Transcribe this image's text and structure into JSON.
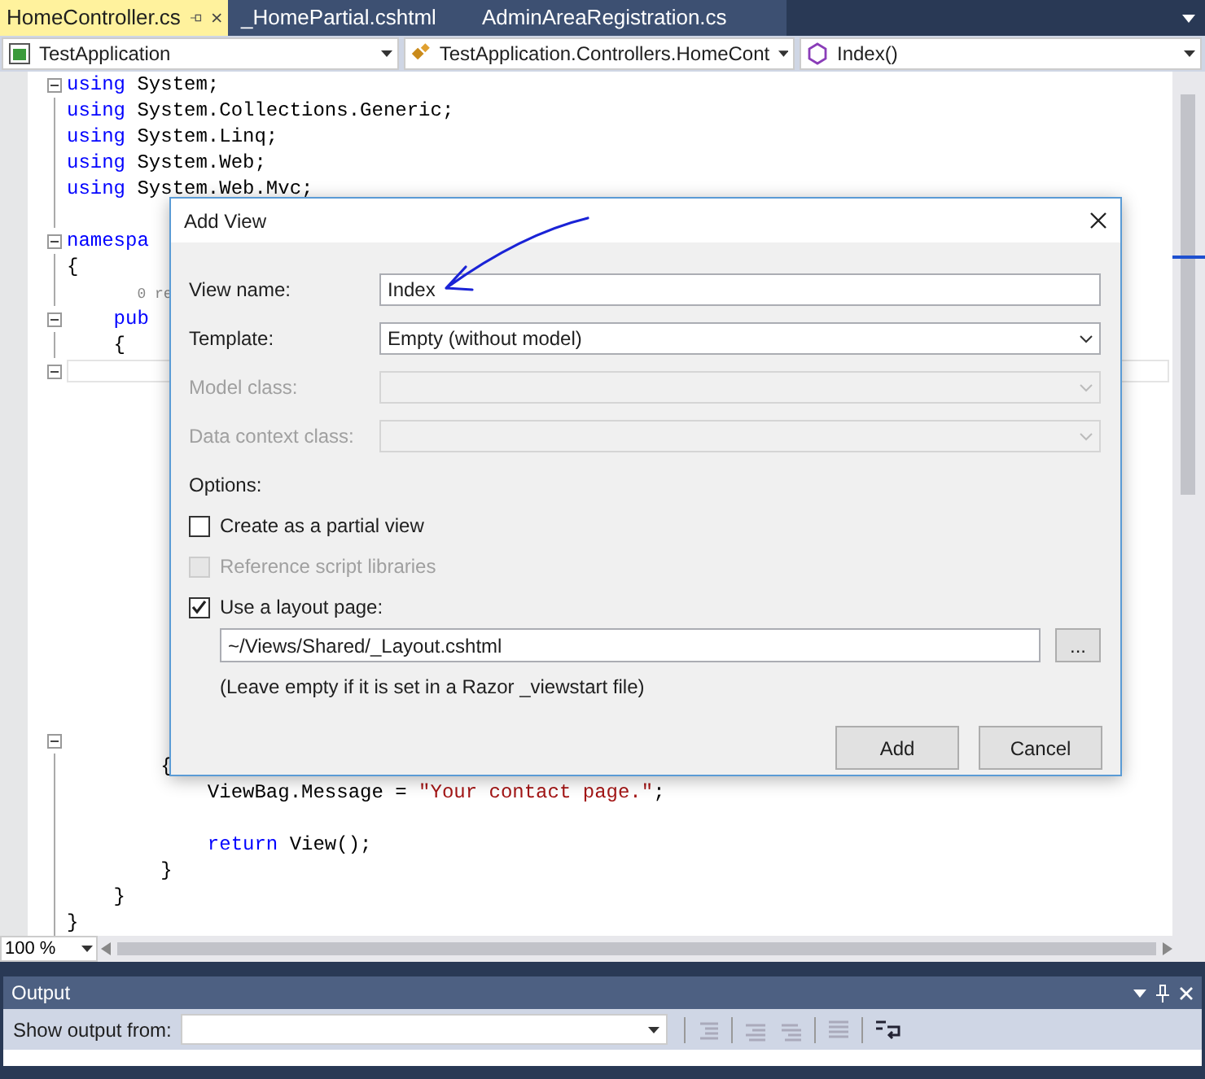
{
  "tabs": [
    {
      "label": "HomeController.cs",
      "selected": true
    },
    {
      "label": "_HomePartial.cshtml",
      "selected": false
    },
    {
      "label": "AdminAreaRegistration.cs",
      "selected": false
    }
  ],
  "nav_dropdowns": [
    {
      "text": "TestApplication",
      "kind": "project"
    },
    {
      "text": "TestApplication.Controllers.HomeCont",
      "kind": "class"
    },
    {
      "text": "Index()",
      "kind": "method"
    }
  ],
  "code_top": [
    {
      "kind": "code",
      "fold": true,
      "tokens": [
        {
          "text": "using",
          "kind": "keyword"
        },
        {
          "text": " System;",
          "kind": "plain"
        }
      ]
    },
    {
      "kind": "code",
      "fold": false,
      "tokens": [
        {
          "text": "using",
          "kind": "keyword"
        },
        {
          "text": " System.Collections.Generic;",
          "kind": "plain"
        }
      ]
    },
    {
      "kind": "code",
      "fold": false,
      "tokens": [
        {
          "text": "using",
          "kind": "keyword"
        },
        {
          "text": " System.Linq;",
          "kind": "plain"
        }
      ]
    },
    {
      "kind": "code",
      "fold": false,
      "tokens": [
        {
          "text": "using",
          "kind": "keyword"
        },
        {
          "text": " System.Web;",
          "kind": "plain"
        }
      ]
    },
    {
      "kind": "code",
      "fold": false,
      "tokens": [
        {
          "text": "using",
          "kind": "keyword"
        },
        {
          "text": " System.Web.Mvc;",
          "kind": "plain"
        }
      ]
    },
    {
      "kind": "blank",
      "fold": false
    },
    {
      "kind": "code",
      "fold": true,
      "tokens": [
        {
          "text": "namespa",
          "kind": "keyword"
        }
      ]
    },
    {
      "kind": "code",
      "fold": false,
      "tokens": [
        {
          "text": "{",
          "kind": "plain"
        }
      ]
    },
    {
      "kind": "lens",
      "fold": false,
      "tokens": [
        {
          "text": "        0 re",
          "kind": "lens"
        }
      ]
    },
    {
      "kind": "code",
      "fold": true,
      "tokens": [
        {
          "text": "    pub",
          "kind": "keyword"
        }
      ]
    },
    {
      "kind": "code",
      "fold": false,
      "tokens": [
        {
          "text": "    {",
          "kind": "plain"
        }
      ]
    },
    {
      "kind": "current",
      "fold": true
    }
  ],
  "code_bottom": [
    {
      "kind": "blank",
      "fold": true
    },
    {
      "kind": "code",
      "fold": false,
      "tokens": [
        {
          "text": "        {",
          "kind": "plain"
        }
      ]
    },
    {
      "kind": "code",
      "fold": false,
      "tokens": [
        {
          "text": "            ViewBag.Message = ",
          "kind": "plain"
        },
        {
          "text": "\"Your contact page.\"",
          "kind": "string"
        },
        {
          "text": ";",
          "kind": "plain"
        }
      ]
    },
    {
      "kind": "blank",
      "fold": false
    },
    {
      "kind": "code",
      "fold": false,
      "tokens": [
        {
          "text": "            return",
          "kind": "keyword"
        },
        {
          "text": " View();",
          "kind": "plain"
        }
      ]
    },
    {
      "kind": "code",
      "fold": false,
      "tokens": [
        {
          "text": "        }",
          "kind": "plain"
        }
      ]
    },
    {
      "kind": "code",
      "fold": false,
      "tokens": [
        {
          "text": "    }",
          "kind": "plain"
        }
      ]
    },
    {
      "kind": "code",
      "fold": false,
      "tokens": [
        {
          "text": "}",
          "kind": "plain"
        }
      ]
    }
  ],
  "dialog": {
    "title": "Add View",
    "fields": [
      {
        "label": "View name:",
        "value": "Index",
        "kind": "text",
        "disabled": false
      },
      {
        "label": "Template:",
        "value": "Empty (without model)",
        "kind": "select",
        "disabled": false
      },
      {
        "label": "Model class:",
        "kind": "select",
        "disabled": true
      },
      {
        "label": "Data context class:",
        "kind": "select",
        "disabled": true
      }
    ],
    "options_label": "Options:",
    "checkboxes": [
      {
        "label": "Create as a partial view",
        "checked": false,
        "disabled": false
      },
      {
        "label": "Reference script libraries",
        "checked": false,
        "disabled": true
      },
      {
        "label": "Use a layout page:",
        "checked": true,
        "disabled": false
      }
    ],
    "layout_path": "~/Views/Shared/_Layout.cshtml",
    "browse_button": "...",
    "hint": "(Leave empty if it is set in a Razor _viewstart file)",
    "buttons": [
      "Add",
      "Cancel"
    ]
  },
  "zoom": "100 %",
  "output": {
    "title": "Output",
    "show_from_label": "Show output from:"
  }
}
